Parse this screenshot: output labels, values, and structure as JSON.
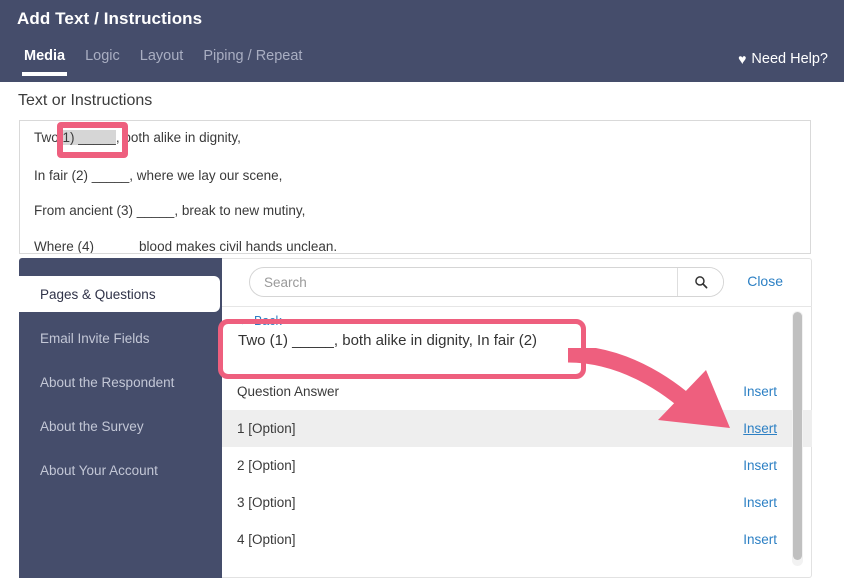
{
  "header": {
    "title": "Add Text / Instructions",
    "tabs": [
      {
        "label": "Media",
        "active": true
      },
      {
        "label": "Logic",
        "active": false
      },
      {
        "label": "Layout",
        "active": false
      },
      {
        "label": "Piping / Repeat",
        "active": false
      }
    ],
    "need_help_label": "Need Help?",
    "heart_icon": "♥"
  },
  "editor": {
    "section_label": "Text or Instructions",
    "lines": [
      {
        "prefix": "Two ",
        "merge": "1) _____",
        "suffix": ", both alike in dignity,"
      },
      {
        "prefix": "In fair (2) _____, where we lay our scene,",
        "merge": "",
        "suffix": ""
      },
      {
        "prefix": "From ancient (3) _____, break to new mutiny,",
        "merge": "",
        "suffix": ""
      },
      {
        "prefix": "Where (4) _____ blood makes civil hands unclean.",
        "merge": "",
        "suffix": ""
      }
    ]
  },
  "picker": {
    "sidebar_items": [
      {
        "label": "Pages & Questions",
        "active": true
      },
      {
        "label": "Email Invite Fields",
        "active": false
      },
      {
        "label": "About the Respondent",
        "active": false
      },
      {
        "label": "About the Survey",
        "active": false
      },
      {
        "label": "About Your Account",
        "active": false
      }
    ],
    "search": {
      "value": "",
      "placeholder": "Search",
      "icon": "search-icon"
    },
    "close_label": "Close",
    "back_label": "← Back",
    "crumb_title": "Two (1) _____, both alike in dignity, In fair (2)",
    "rows": [
      {
        "label": "Question Answer",
        "action": "Insert",
        "hover": false
      },
      {
        "label": "1 [Option]",
        "action": "Insert",
        "hover": true
      },
      {
        "label": "2 [Option]",
        "action": "Insert",
        "hover": false
      },
      {
        "label": "3 [Option]",
        "action": "Insert",
        "hover": false
      },
      {
        "label": "4 [Option]",
        "action": "Insert",
        "hover": false
      }
    ]
  },
  "annotations": {
    "color": "#ee5f7e",
    "editor_highlight_target": "1) _____",
    "crumb_highlight_target": "Two (1) _____, both alike in dignity, In fair (2)",
    "arrow_points_to": "Insert"
  },
  "colors": {
    "header_navy": "#454d6b",
    "link_blue": "#2d80c4",
    "annotation_pink": "#ee5f7e",
    "row_hover": "#eeeeee"
  }
}
